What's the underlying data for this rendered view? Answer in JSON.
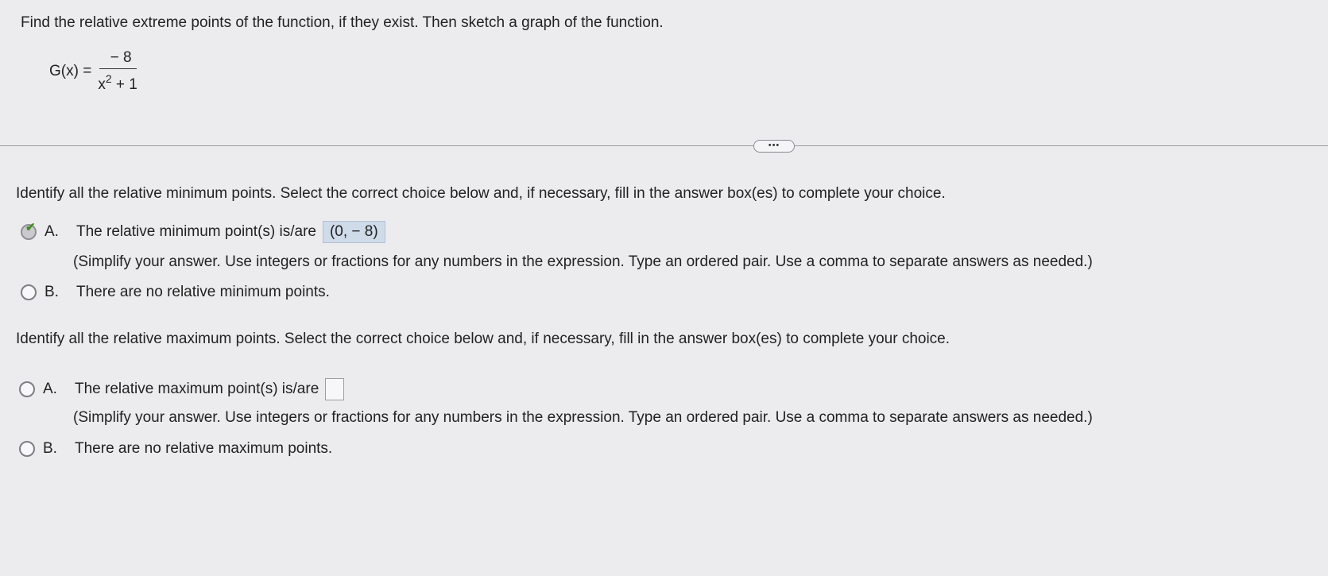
{
  "problem": {
    "instruction": "Find the relative extreme points of the function, if they exist. Then sketch a graph of the function.",
    "function_label": "G(x) =",
    "numerator": "− 8",
    "denominator_base": "x",
    "denominator_exp": "2",
    "denominator_rest": "+ 1"
  },
  "expand_button": "•••",
  "minimum": {
    "prompt": "Identify all the relative minimum points. Select the correct choice below and, if necessary, fill in the answer box(es) to complete your choice.",
    "choice_a_letter": "A.",
    "choice_a_text": "The relative minimum point(s) is/are",
    "choice_a_answer": "(0, − 8)",
    "choice_a_hint": "(Simplify your answer. Use integers or fractions for any numbers in the expression. Type an ordered pair. Use a comma to separate answers as needed.)",
    "choice_b_letter": "B.",
    "choice_b_text": "There are no relative minimum points."
  },
  "maximum": {
    "prompt": "Identify all the relative maximum points. Select the correct choice below and, if necessary, fill in the answer box(es) to complete your choice.",
    "choice_a_letter": "A.",
    "choice_a_text": "The relative maximum point(s) is/are",
    "choice_a_hint": "(Simplify your answer. Use integers or fractions for any numbers in the expression. Type an ordered pair. Use a comma to separate answers as needed.)",
    "choice_b_letter": "B.",
    "choice_b_text": "There are no relative maximum points."
  }
}
